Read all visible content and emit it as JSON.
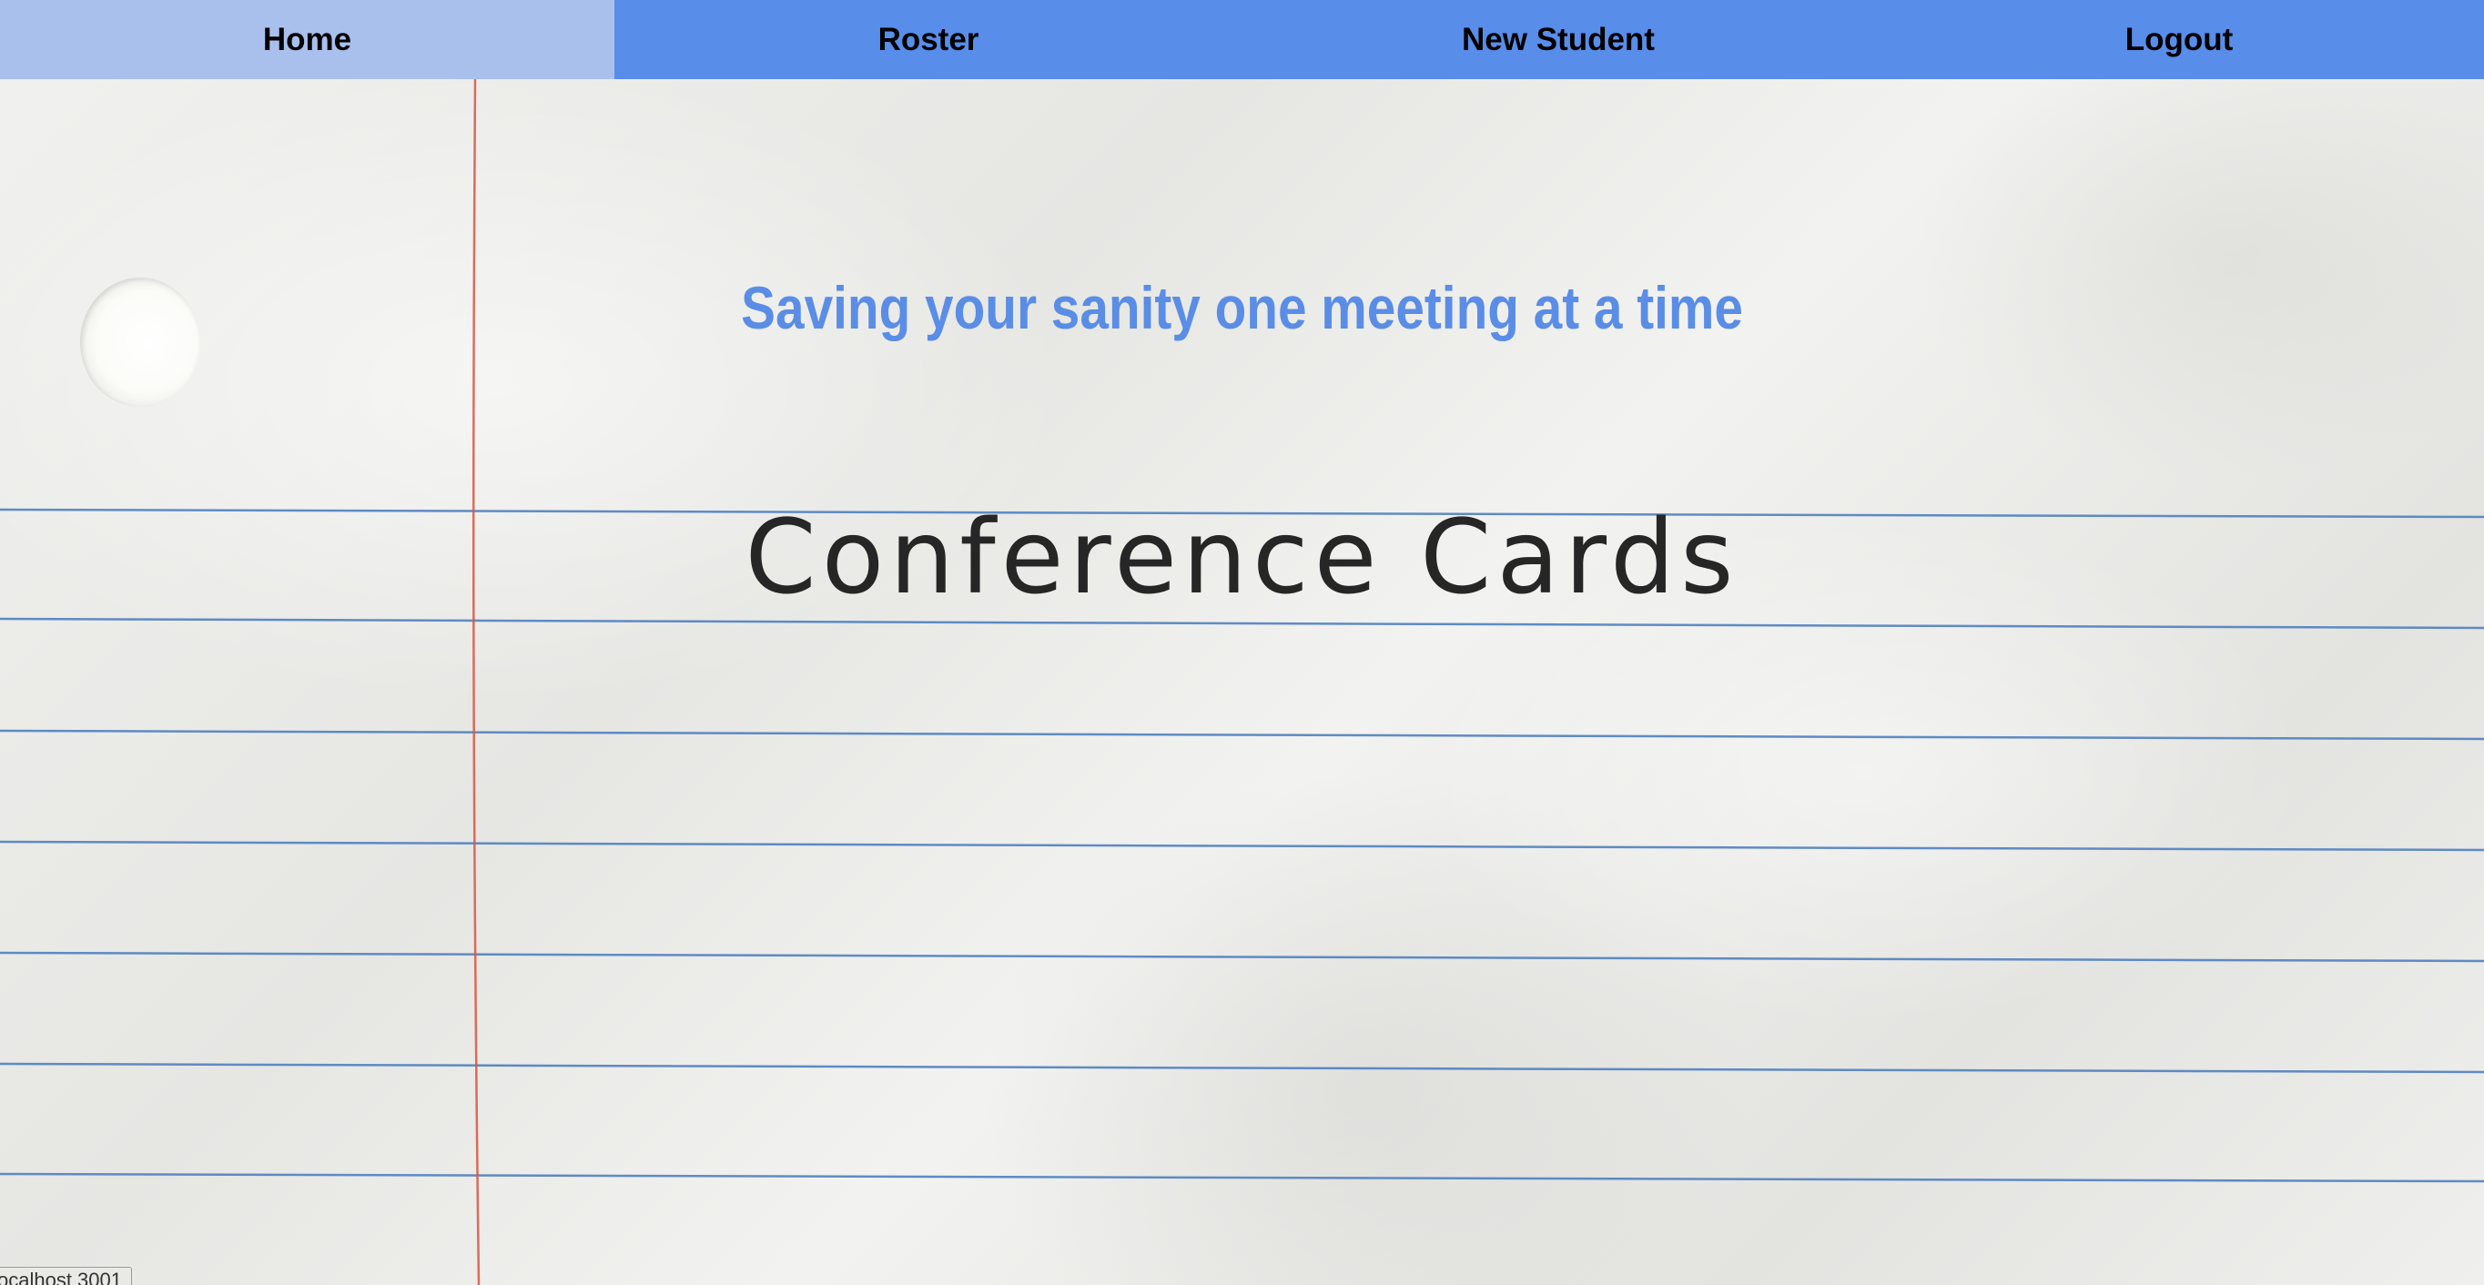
{
  "nav": {
    "items": [
      {
        "label": "Home",
        "active": true
      },
      {
        "label": "Roster",
        "active": false
      },
      {
        "label": "New Student",
        "active": false
      },
      {
        "label": "Logout",
        "active": false
      }
    ]
  },
  "main": {
    "tagline": "Saving your sanity one meeting at a time",
    "title": "Conference Cards"
  },
  "footer": {
    "badge": "ocalhost 3001"
  },
  "colors": {
    "nav_background": "#588de9",
    "nav_active": "#a9c0ed",
    "tagline": "#5a8de6",
    "title": "#262626",
    "ruled_line": "#4f7fbf",
    "margin_line": "#d9533f"
  },
  "background": {
    "type": "crumpled lined notebook paper"
  }
}
